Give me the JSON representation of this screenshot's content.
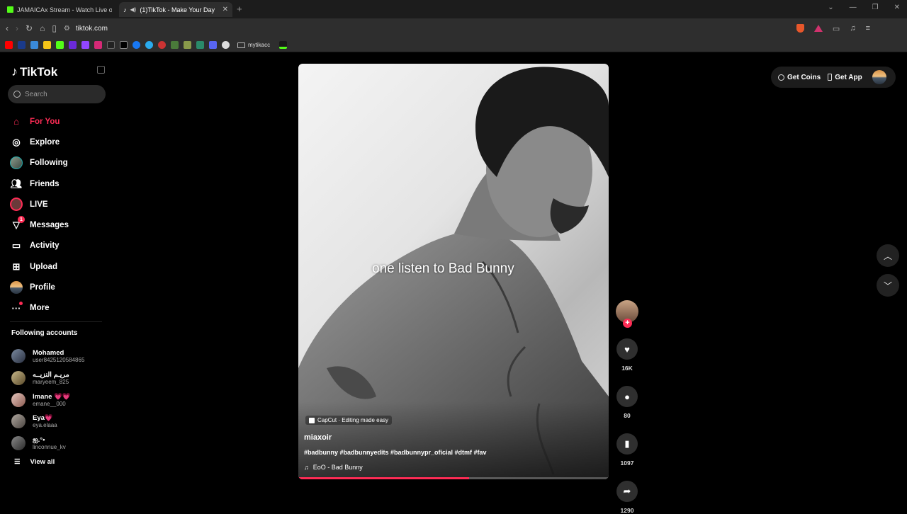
{
  "browser": {
    "tabs": [
      {
        "title": "JAMAICAx Stream - Watch Live on K"
      },
      {
        "title": "(1)TikTok - Make Your Day",
        "active": true
      }
    ],
    "url": "tiktok.com",
    "bookmark_folder": "mytikacc"
  },
  "sidebar": {
    "logo": "TikTok",
    "search_placeholder": "Search",
    "nav": [
      {
        "label": "For You"
      },
      {
        "label": "Explore"
      },
      {
        "label": "Following"
      },
      {
        "label": "Friends"
      },
      {
        "label": "LIVE"
      },
      {
        "label": "Messages",
        "badge": "1"
      },
      {
        "label": "Activity"
      },
      {
        "label": "Upload"
      },
      {
        "label": "Profile"
      },
      {
        "label": "More"
      }
    ],
    "following_title": "Following accounts",
    "accounts": [
      {
        "name": "Mohamed",
        "user": "user8425120584865"
      },
      {
        "name": "مريـم النزيــه",
        "user": "maryeem_825"
      },
      {
        "name": "Imane 💗💗",
        "user": "emane__000"
      },
      {
        "name": "Eya💗",
        "user": "eya.elaaa"
      },
      {
        "name": "ஐ.°•",
        "user": "linconnue_kv"
      }
    ],
    "view_all": "View all"
  },
  "video": {
    "overlay_text": "one listen to Bad Bunny",
    "capcut": "CapCut · Editing made easy",
    "author": "miaxoir",
    "tags": "#badbunny #badbunnyedits #badbunnypr_oficial #dtmf #fav",
    "music": "EoO - Bad Bunny",
    "progress": 0.55
  },
  "actions": {
    "likes": "16K",
    "comments": "80",
    "saves": "1097",
    "shares": "1290"
  },
  "topbar": {
    "get_coins": "Get Coins",
    "get_app": "Get App"
  },
  "colors": {
    "accent": "#fe2c55",
    "background": "#000000"
  }
}
